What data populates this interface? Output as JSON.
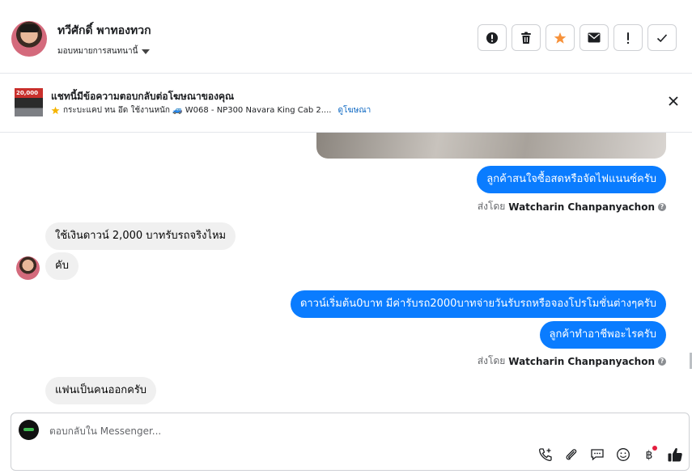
{
  "header": {
    "contact_name": "ทวีศักดิ์ พาทองทวก",
    "assign_label": "มอบหมายการสนทนานี้",
    "actions": [
      {
        "name": "mark-spam-button",
        "icon": "alert-circle-icon"
      },
      {
        "name": "delete-button",
        "icon": "trash-icon"
      },
      {
        "name": "star-button",
        "icon": "star-icon"
      },
      {
        "name": "mark-unread-button",
        "icon": "envelope-icon"
      },
      {
        "name": "follow-up-button",
        "icon": "exclamation-icon"
      },
      {
        "name": "mark-done-button",
        "icon": "checkmark-icon"
      }
    ]
  },
  "ad_banner": {
    "thumb_text": "20,000",
    "title": "แชทนี้มีข้อความตอบกลับต่อโฆษณาของคุณ",
    "subtitle": "กระบะแคป ทน อึด ใช้งานหนัก 🚙 W068 - NP300 Navara King Cab 2....",
    "link_text": "ดูโฆษณา",
    "close_icon": "close-icon"
  },
  "messages": [
    {
      "dir": "out",
      "text": "ลูกค้าสนใจซื้อสดหรือจัดไฟแนนซ์ครับ"
    },
    {
      "dir": "meta",
      "prefix": "ส่งโดย",
      "sender": "Watcharin Chanpanyachon"
    },
    {
      "dir": "in",
      "text": "ใช้เงินดาวน์ 2,000 บาทรับรถจริงไหม"
    },
    {
      "dir": "in",
      "text": "คับ"
    },
    {
      "dir": "out",
      "text": "ดาวน์เริ่มต้น0บาท มีค่ารับรถ2000บาทจ่ายวันรับรถหรือจองโปรโมชั่นต่างๆครับ"
    },
    {
      "dir": "out",
      "text": "ลูกค้าทำอาชีพอะไรครับ"
    },
    {
      "dir": "meta",
      "prefix": "ส่งโดย",
      "sender": "Watcharin Chanpanyachon"
    },
    {
      "dir": "in",
      "text": "แฟนเป็นคนออกครับ"
    }
  ],
  "composer": {
    "placeholder": "ตอบกลับใน Messenger...",
    "value": "",
    "tools": [
      "add-call-icon",
      "attachment-icon",
      "saved-reply-icon",
      "emoji-icon",
      "baht-payment-icon",
      "thumbs-up-icon"
    ]
  },
  "colors": {
    "outgoing_bubble": "#0a7cff",
    "incoming_bubble": "#f0f0f0",
    "link": "#0a66c2",
    "star": "#f7923b",
    "notification_dot": "#e41e3f"
  }
}
